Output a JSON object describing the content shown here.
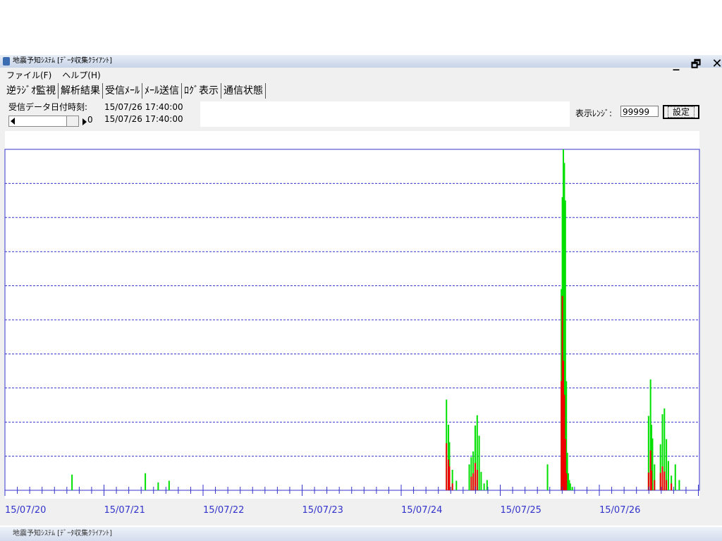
{
  "window": {
    "title": "地震予知ｼｽﾃﾑ [ﾃﾞｰﾀ収集ｸﾗｲｱﾝﾄ]",
    "minimize_label": "_",
    "restore_label": "🗗",
    "close_label": "✕"
  },
  "menu": {
    "file": "ファイル(F)",
    "help": "ヘルプ(H)"
  },
  "tabs": [
    {
      "label": "逆ﾗｼﾞｵ監視",
      "active": true
    },
    {
      "label": "解析結果",
      "active": false
    },
    {
      "label": "受信ﾒｰﾙ",
      "active": false
    },
    {
      "label": "ﾒｰﾙ送信",
      "active": false
    },
    {
      "label": "ﾛｸﾞ表示",
      "active": false
    },
    {
      "label": "通信状態",
      "active": false
    }
  ],
  "info": {
    "received_label": "受信データ日付時刻:",
    "received_value": "15/07/26 17:40:00",
    "slider_value": "0",
    "slider_time": "15/07/26 17:40:00"
  },
  "range": {
    "label": "表示ﾚﾝｼﾞ:",
    "value": "99999",
    "set_button": "設定"
  },
  "second_window_title": "地震予知ｼｽﾃﾑ [ﾃﾞｰﾀ収集ｸﾗｲｱﾝﾄ]",
  "colors": {
    "frame": "#3333cc",
    "grid": "#3333cc",
    "green": "#00e000",
    "red": "#ee0000"
  },
  "chart_data": {
    "type": "bar",
    "x_tick_labels": [
      "15/07/20",
      "15/07/21",
      "15/07/22",
      "15/07/23",
      "15/07/24",
      "15/07/25",
      "15/07/26"
    ],
    "x_days": 7,
    "y_gridlines": 10,
    "grid": true,
    "series": [
      {
        "color": "green",
        "x": [
          0.67,
          1.41,
          1.54,
          1.65,
          4.45,
          4.47,
          4.48,
          4.51,
          4.55,
          4.68,
          4.7,
          4.72,
          4.74,
          4.76,
          4.78,
          4.8,
          4.83,
          4.86,
          5.47,
          5.61,
          5.62,
          5.63,
          5.64,
          5.65,
          5.66,
          5.67,
          5.68,
          5.69,
          5.7,
          5.72,
          6.49,
          6.51,
          6.52,
          6.53,
          6.55,
          6.61,
          6.63,
          6.65,
          6.67,
          6.69,
          6.72,
          6.76,
          6.8
        ],
        "values": [
          0.046,
          0.05,
          0.023,
          0.028,
          0.266,
          0.192,
          0.141,
          0.06,
          0.028,
          0.076,
          0.097,
          0.114,
          0.19,
          0.22,
          0.16,
          0.054,
          0.02,
          0.03,
          0.076,
          0.59,
          0.86,
          1.0,
          0.96,
          0.85,
          0.32,
          0.11,
          0.05,
          0.03,
          0.02,
          0.01,
          0.218,
          0.325,
          0.192,
          0.152,
          0.076,
          0.135,
          0.223,
          0.24,
          0.15,
          0.086,
          0.043,
          0.076,
          0.03
        ]
      },
      {
        "color": "red",
        "x": [
          4.45,
          4.47,
          4.48,
          4.51,
          4.7,
          4.72,
          4.74,
          4.76,
          5.61,
          5.62,
          5.63,
          5.64,
          5.65,
          5.66,
          6.49,
          6.51,
          6.52,
          6.55,
          6.61,
          6.63,
          6.65,
          6.67,
          6.72
        ],
        "values": [
          0.138,
          0.09,
          0.07,
          0.02,
          0.04,
          0.05,
          0.08,
          0.06,
          0.32,
          0.57,
          0.38,
          0.28,
          0.15,
          0.05,
          0.052,
          0.117,
          0.058,
          0.03,
          0.051,
          0.07,
          0.055,
          0.03,
          0.02
        ]
      }
    ]
  }
}
